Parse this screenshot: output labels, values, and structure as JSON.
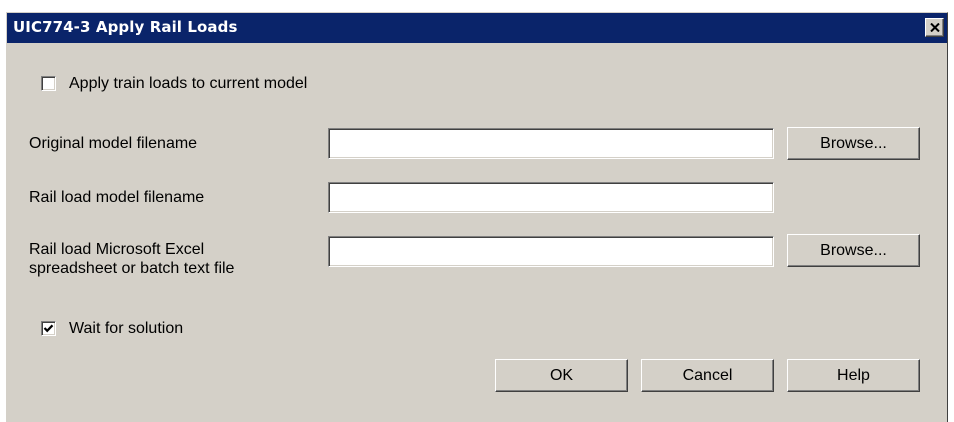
{
  "window": {
    "title": "UIC774-3 Apply Rail Loads",
    "close_glyph": "✕"
  },
  "form": {
    "apply_train_loads": {
      "label": "Apply train loads to current model",
      "checked": false
    },
    "original_model": {
      "label": "Original model filename",
      "value": "",
      "browse_label": "Browse..."
    },
    "rail_load_model": {
      "label": "Rail load model filename",
      "value": ""
    },
    "rail_load_spreadsheet": {
      "label_line1": "Rail load Microsoft Excel",
      "label_line2": "spreadsheet or batch text file",
      "value": "",
      "browse_label": "Browse..."
    },
    "wait_for_solution": {
      "label": "Wait for solution",
      "checked": true
    }
  },
  "buttons": {
    "ok": "OK",
    "cancel": "Cancel",
    "help": "Help"
  },
  "colors": {
    "titlebar": "#0a246a",
    "face": "#d4d0c8"
  },
  "icons": {
    "close": "close-icon",
    "check": "checkmark-icon"
  }
}
